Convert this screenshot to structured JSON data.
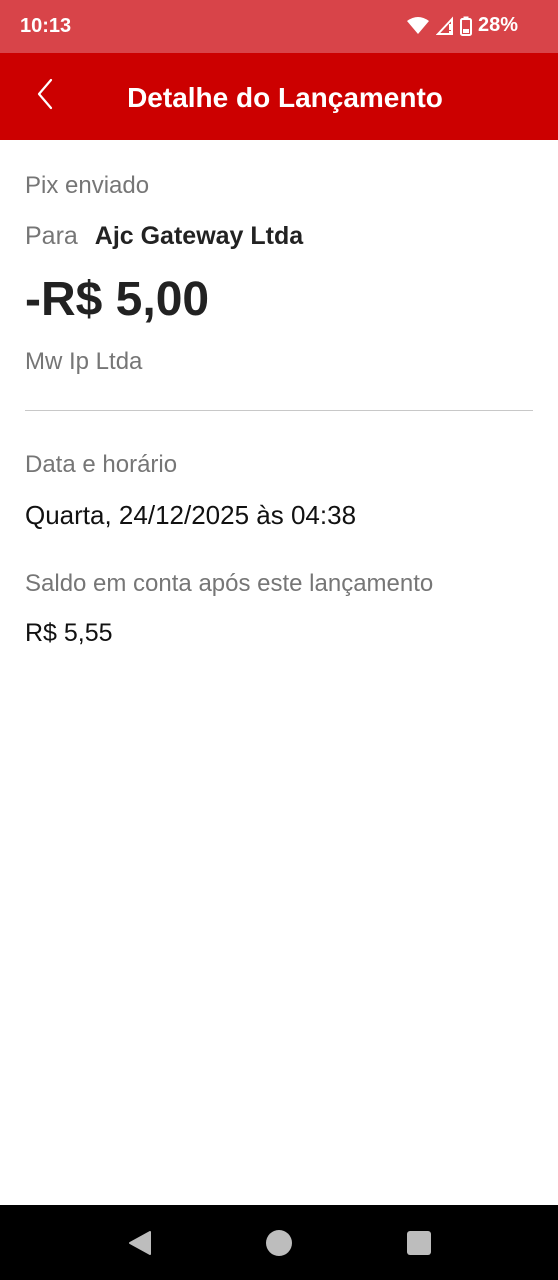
{
  "status_bar": {
    "time": "10:13",
    "battery": "28%",
    "icons": [
      "wifi-icon",
      "signal-icon",
      "battery-icon"
    ]
  },
  "app_bar": {
    "title": "Detalhe do Lançamento",
    "back_icon": "chevron-left-icon",
    "color": "#cc0000"
  },
  "transaction": {
    "type": "Pix enviado",
    "recipient_prefix": "Para",
    "recipient_name": "Ajc Gateway Ltda",
    "amount": "-R$ 5,00",
    "counterparty": "Mw Ip Ltda"
  },
  "details": {
    "date_label": "Data e horário",
    "date_value": "Quarta, 24/12/2025 às 04:38",
    "balance_label": "Saldo em conta após este lançamento",
    "balance_value": "R$ 5,55"
  },
  "nav_bar": {
    "buttons": [
      "back-triangle-icon",
      "home-circle-icon",
      "recents-square-icon"
    ]
  }
}
